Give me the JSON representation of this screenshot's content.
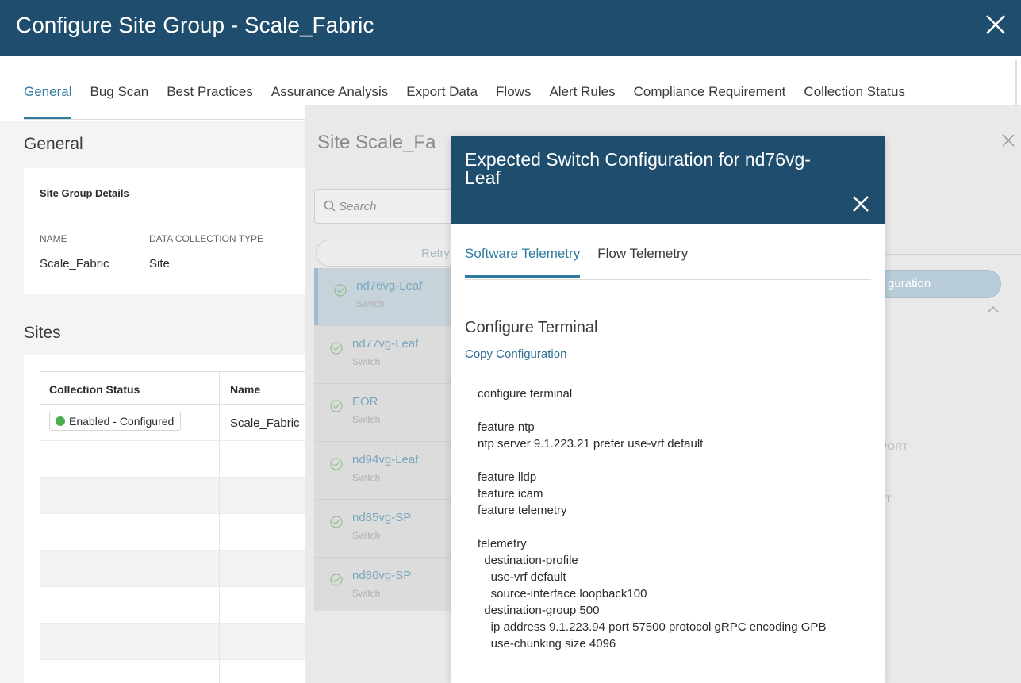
{
  "header": {
    "title": "Configure Site Group - Scale_Fabric",
    "close_icon": "close-icon"
  },
  "tabs": [
    {
      "label": "General",
      "active": true
    },
    {
      "label": "Bug Scan"
    },
    {
      "label": "Best Practices"
    },
    {
      "label": "Assurance Analysis"
    },
    {
      "label": "Export Data"
    },
    {
      "label": "Flows"
    },
    {
      "label": "Alert Rules"
    },
    {
      "label": "Compliance Requirement"
    },
    {
      "label": "Collection Status"
    }
  ],
  "general": {
    "heading": "General",
    "card_title": "Site Group Details",
    "name_label": "NAME",
    "name_value": "Scale_Fabric",
    "type_label": "DATA COLLECTION TYPE",
    "type_value": "Site"
  },
  "sites": {
    "heading": "Sites",
    "columns": [
      "Collection Status",
      "Name"
    ],
    "rows": [
      {
        "status": "Enabled - Configured",
        "name": "Scale_Fabric"
      }
    ],
    "status_color": "#4cae4c"
  },
  "site_panel": {
    "title": "Site Scale_Fa",
    "search_placeholder": "Search",
    "retry_label": "Retry",
    "switches": [
      {
        "name": "nd76vg-Leaf",
        "type": "Switch",
        "selected": true
      },
      {
        "name": "nd77vg-Leaf",
        "type": "Switch"
      },
      {
        "name": "EOR",
        "type": "Switch"
      },
      {
        "name": "nd94vg-Leaf",
        "type": "Switch"
      },
      {
        "name": "nd85vg-SP",
        "type": "Switch"
      },
      {
        "name": "nd86vg-SP",
        "type": "Switch"
      }
    ],
    "ghost_button_label": "guration",
    "ghost_label_1": "PORT",
    "ghost_label_2": "T"
  },
  "modal": {
    "title": "Expected Switch Configuration for nd76vg-Leaf",
    "tabs": [
      {
        "label": "Software Telemetry",
        "active": true
      },
      {
        "label": "Flow Telemetry"
      }
    ],
    "section_title": "Configure Terminal",
    "copy_link": "Copy Configuration",
    "config_text": "configure terminal\n\nfeature ntp\nntp server 9.1.223.21 prefer use-vrf default\n\nfeature lldp\nfeature icam\nfeature telemetry\n\ntelemetry\n  destination-profile\n    use-vrf default\n    source-interface loopback100\n  destination-group 500\n    ip address 9.1.223.94 port 57500 protocol gRPC encoding GPB\n    use-chunking size 4096"
  },
  "colors": {
    "header_bg": "#1e4d6e",
    "accent": "#2f7b9f"
  }
}
